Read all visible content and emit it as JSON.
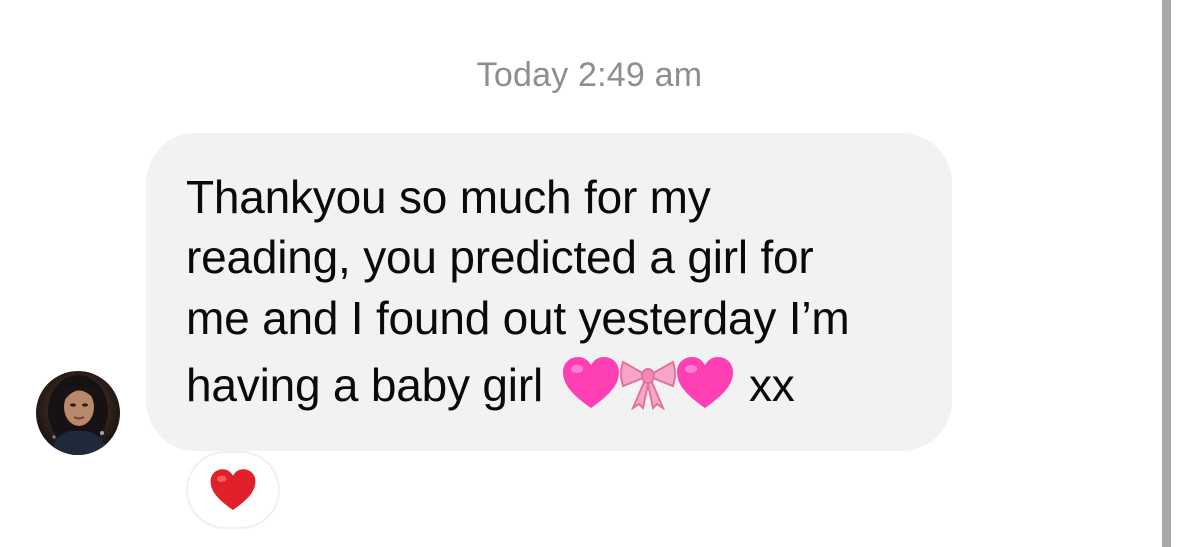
{
  "conversation": {
    "timestamp": "Today 2:49 am",
    "message": {
      "lines": [
        "Thankyou so much for my",
        "reading, you predicted a girl for",
        "me and I found out yesterday I’m",
        "having a baby girl"
      ],
      "trailing_text": "xx",
      "emojis": [
        "pink-heart-icon",
        "ribbon-icon",
        "pink-heart-icon"
      ]
    },
    "reaction": {
      "icon": "red-heart-icon",
      "color": "#e0202a"
    }
  },
  "colors": {
    "bubble": "#f2f2f2",
    "timestamp": "#8e8e8e",
    "text": "#0a0a0a",
    "pink_heart": "#ff3fb4",
    "ribbon": "#f7a6c9"
  }
}
